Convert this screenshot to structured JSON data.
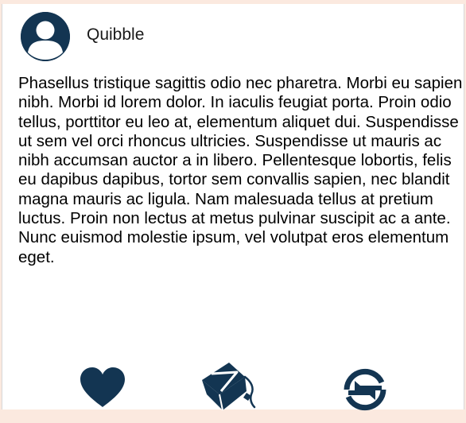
{
  "post": {
    "author": "Quibble",
    "avatar_icon": "user-avatar-icon",
    "text": "Phasellus tristique sagittis odio nec pharetra. Morbi eu sapien nibh. Morbi id lorem dolor. In iaculis feugiat porta. Proin odio tellus, porttitor eu leo at, elementum aliquet dui. Suspendisse ut sem vel orci rhoncus ultricies. Suspendisse ut mauris ac nibh accumsan auctor a in libero. Pellentesque lobortis, felis eu dapibus dapibus, tortor sem convallis sapien, nec blandit magna mauris ac ligula. Nam malesuada tellus at pretium luctus. Proin non lectus at metus pulvinar suscipit ac a ante. Nunc euismod molestie ipsum, vel volutpat eros elementum eget."
  },
  "actions": {
    "like_icon": "heart-icon",
    "share_icon": "paper-plane-icon",
    "reblog_icon": "reblog-icon"
  },
  "colors": {
    "accent": "#133552",
    "page_background": "#fbe9df",
    "card_background": "#ffffff"
  }
}
